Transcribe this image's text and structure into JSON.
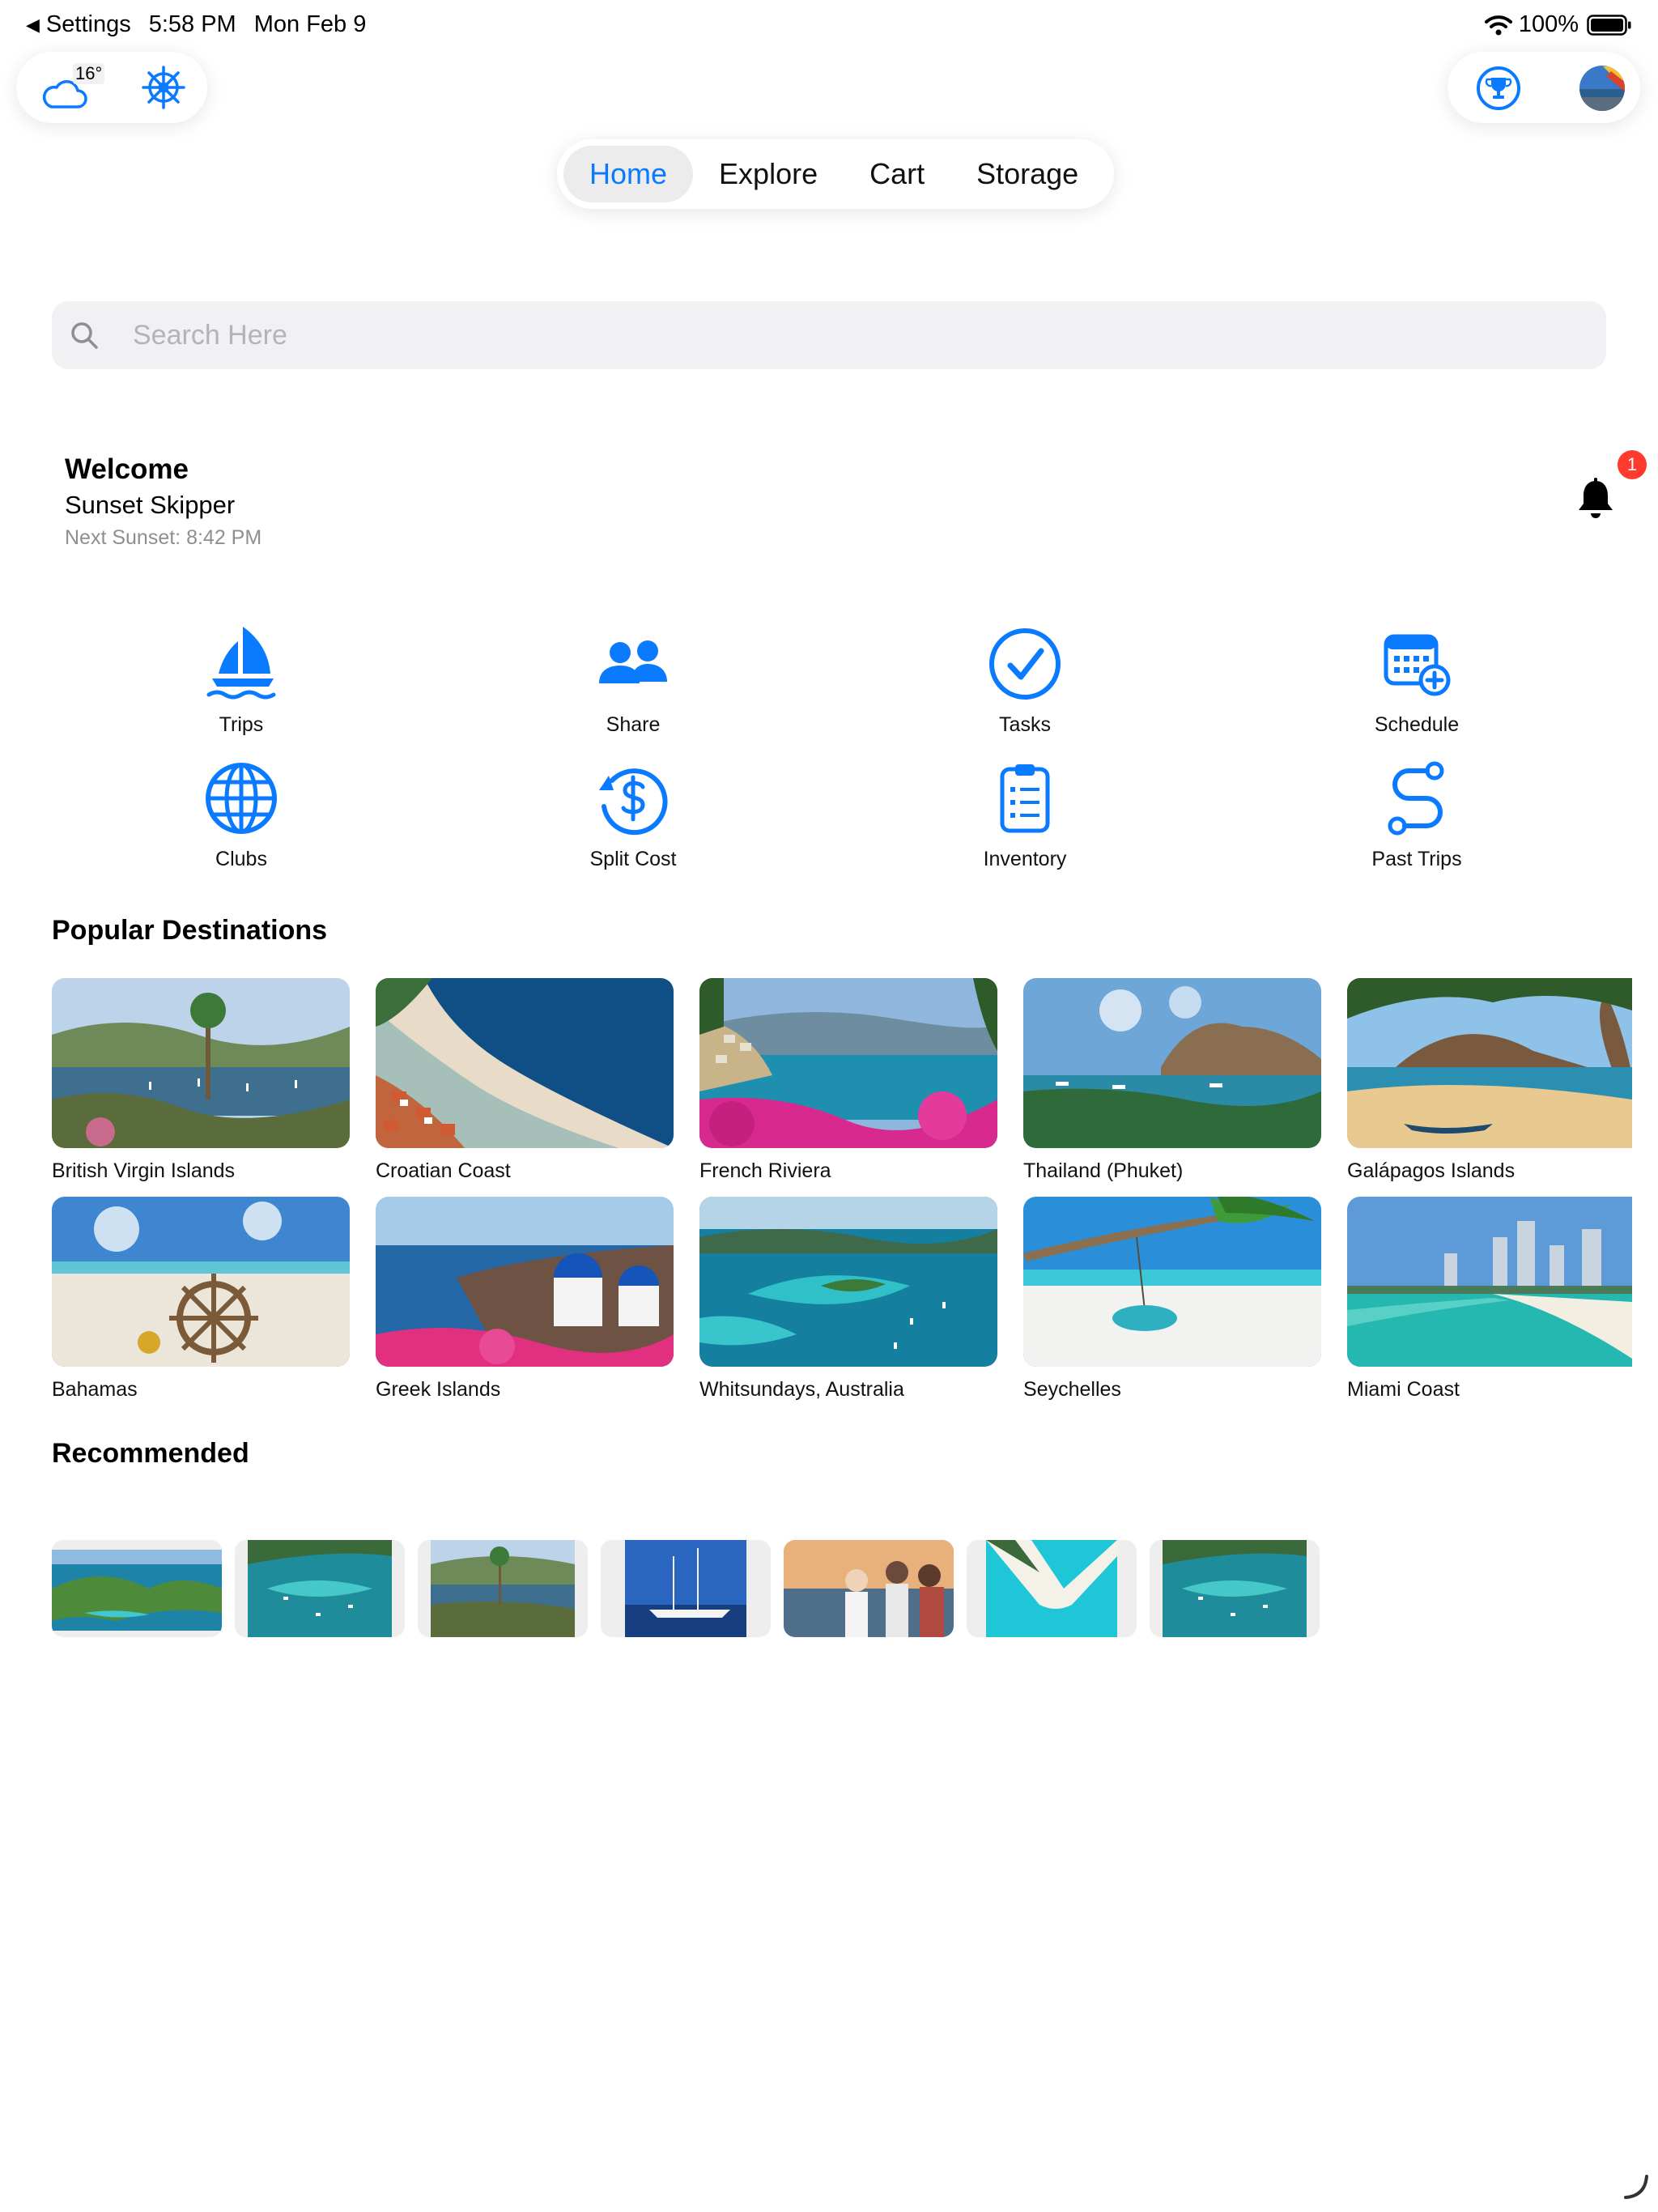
{
  "status_bar": {
    "back_label": "Settings",
    "time": "5:58 PM",
    "date": "Mon Feb 9",
    "battery": "100%"
  },
  "weather": {
    "temperature": "16°"
  },
  "tabs": [
    {
      "label": "Home",
      "active": true
    },
    {
      "label": "Explore",
      "active": false
    },
    {
      "label": "Cart",
      "active": false
    },
    {
      "label": "Storage",
      "active": false
    }
  ],
  "search": {
    "placeholder": "Search Here"
  },
  "welcome": {
    "heading": "Welcome",
    "name": "Sunset Skipper",
    "next_sunset": "Next Sunset: 8:42 PM",
    "notification_count": "1"
  },
  "quick_actions": [
    {
      "label": "Trips",
      "icon": "sailboat-icon"
    },
    {
      "label": "Share",
      "icon": "people-icon"
    },
    {
      "label": "Tasks",
      "icon": "checkmark-circle-icon"
    },
    {
      "label": "Schedule",
      "icon": "calendar-add-icon"
    },
    {
      "label": "Clubs",
      "icon": "globe-icon"
    },
    {
      "label": "Split Cost",
      "icon": "dollar-refresh-icon"
    },
    {
      "label": "Inventory",
      "icon": "clipboard-list-icon"
    },
    {
      "label": "Past Trips",
      "icon": "route-icon"
    }
  ],
  "popular": {
    "title": "Popular Destinations",
    "items": [
      {
        "label": "British Virgin Islands"
      },
      {
        "label": "Croatian Coast"
      },
      {
        "label": "French Riviera"
      },
      {
        "label": "Thailand (Phuket)"
      },
      {
        "label": "Galápagos Islands"
      },
      {
        "label": "Bahamas"
      },
      {
        "label": "Greek Islands"
      },
      {
        "label": "Whitsundays, Australia"
      },
      {
        "label": "Seychelles"
      },
      {
        "label": "Miami Coast"
      }
    ]
  },
  "recommended": {
    "title": "Recommended"
  },
  "colors": {
    "accent": "#0a7aff",
    "badge": "#ff3b30",
    "search_bg": "#f1f1f3"
  }
}
